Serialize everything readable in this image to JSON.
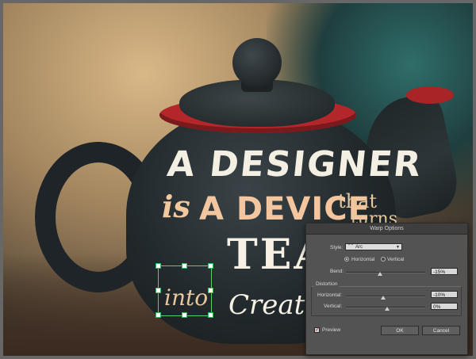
{
  "artwork": {
    "line1": "A DESIGNER",
    "line2_is": "is",
    "line2_main": "A DEVICE",
    "line2_that": "that",
    "line2_turns": "turns",
    "line3": "TEA",
    "line4_into": "into",
    "line4_creativity": "Creativi"
  },
  "dialog": {
    "title": "Warp Options",
    "style_label": "Style:",
    "style_value": "Arc",
    "style_icon": "arc-warp-icon",
    "orientation_horizontal": "Horizontal",
    "orientation_vertical": "Vertical",
    "orientation_selected": "Horizontal",
    "bend_label": "Bend:",
    "bend_value": "-15%",
    "distortion_label": "Distortion",
    "horizontal_label": "Horizontal:",
    "horizontal_value": "-10%",
    "vertical_label": "Vertical:",
    "vertical_value": "0%",
    "preview_label": "Preview",
    "preview_checked": true,
    "ok_label": "OK",
    "cancel_label": "Cancel"
  },
  "colors": {
    "selection": "#52d06f",
    "panel_bg": "#535353",
    "accent_text": "#f3c6a0"
  }
}
